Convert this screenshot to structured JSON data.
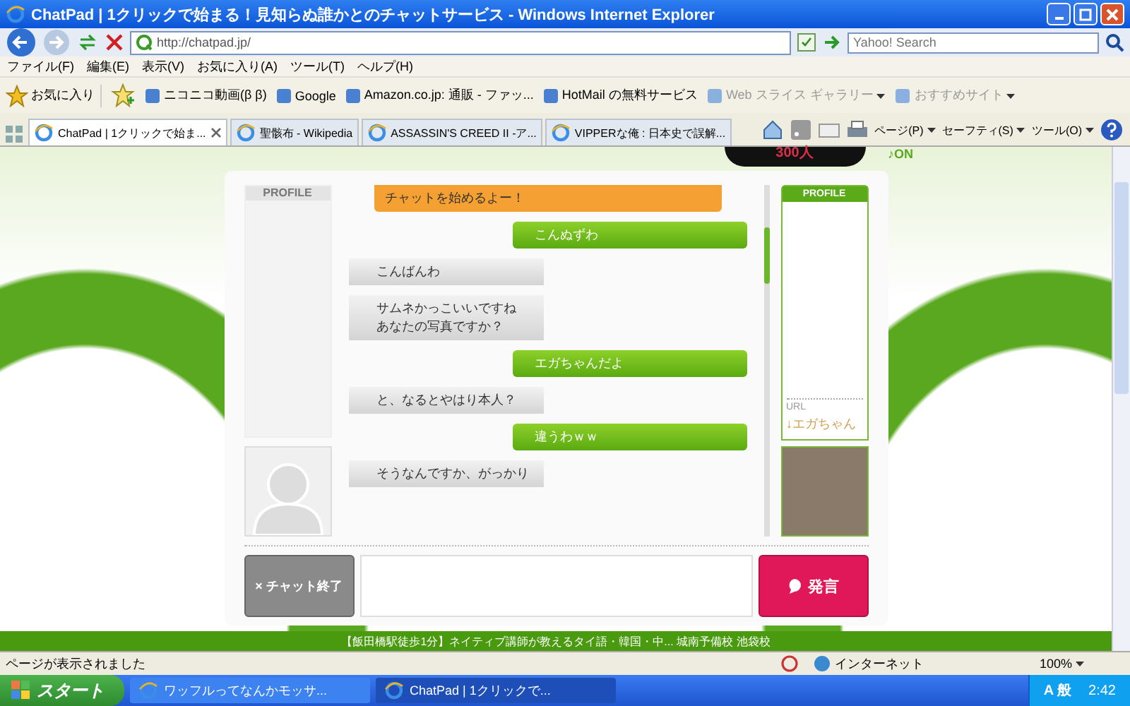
{
  "window": {
    "title": "ChatPad | 1クリックで始まる！見知らぬ誰かとのチャットサービス - Windows Internet Explorer"
  },
  "address_bar": {
    "url": "http://chatpad.jp/"
  },
  "search": {
    "placeholder": "Yahoo! Search"
  },
  "menu": [
    "ファイル(F)",
    "編集(E)",
    "表示(V)",
    "お気に入り(A)",
    "ツール(T)",
    "ヘルプ(H)"
  ],
  "favorites": {
    "label": "お気に入り",
    "links": [
      {
        "label": "ニコニコ動画(β β)",
        "dim": false,
        "dropdown": false
      },
      {
        "label": "Google",
        "dim": false,
        "dropdown": false
      },
      {
        "label": "Amazon.co.jp: 通販 - ファッ...",
        "dim": false,
        "dropdown": false
      },
      {
        "label": "HotMail の無料サービス",
        "dim": false,
        "dropdown": false
      },
      {
        "label": "Web スライス ギャラリー",
        "dim": true,
        "dropdown": true
      },
      {
        "label": "おすすめサイト",
        "dim": true,
        "dropdown": true
      }
    ]
  },
  "tabs": [
    {
      "label": "ChatPad | 1クリックで始ま...",
      "selected": true
    },
    {
      "label": "聖骸布 - Wikipedia",
      "selected": false
    },
    {
      "label": "ASSASSIN'S CREED II -ア...",
      "selected": false
    },
    {
      "label": "VIPPERな俺 : 日本史で誤解...",
      "selected": false
    }
  ],
  "command_bar": [
    "ページ(P)",
    "セーフティ(S)",
    "ツール(O)"
  ],
  "page": {
    "counter": "300人",
    "sound": "♪ON",
    "left_profile": {
      "header": "PROFILE"
    },
    "messages": [
      {
        "kind": "system",
        "lines": [
          "チャットを始めるよー！"
        ]
      },
      {
        "kind": "sent",
        "lines": [
          "こんぬずわ"
        ]
      },
      {
        "kind": "received",
        "lines": [
          "こんばんわ"
        ]
      },
      {
        "kind": "received",
        "lines": [
          "サムネかっこいいですね",
          "あなたの写真ですか？"
        ]
      },
      {
        "kind": "sent",
        "lines": [
          "エガちゃんだよ"
        ]
      },
      {
        "kind": "received",
        "lines": [
          "と、なるとやはり本人？"
        ]
      },
      {
        "kind": "sent",
        "lines": [
          "違うわｗｗ"
        ]
      },
      {
        "kind": "received",
        "lines": [
          "そうなんですか、がっかり"
        ]
      }
    ],
    "right_profile": {
      "header": "PROFILE",
      "url_label": "URL",
      "url": "↓エガちゃん"
    },
    "end_button": "× チャット終了",
    "send_button": "発言",
    "footer_link": "【飯田橋駅徒歩1分】ネイティブ講師が教えるタイ語・韓国・中... 城南予備校 池袋校"
  },
  "status_bar": {
    "text": "ページが表示されました",
    "zone": "インターネット",
    "zoom": "100%"
  },
  "taskbar": {
    "start": "スタート",
    "tasks": [
      {
        "label": "ワッフルってなんかモッサ...",
        "selected": false
      },
      {
        "label": "ChatPad | 1クリックで...",
        "selected": true
      }
    ],
    "ime": "A 般",
    "clock": "2:42"
  }
}
